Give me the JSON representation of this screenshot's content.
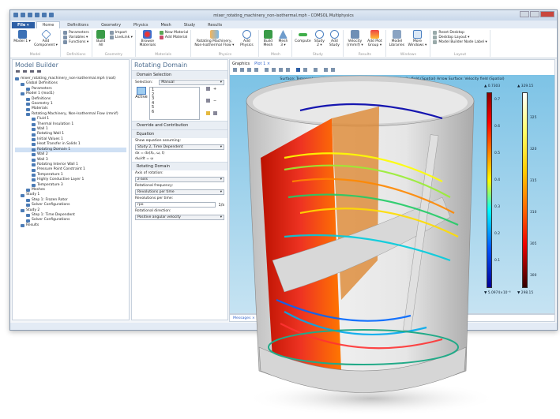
{
  "window": {
    "title": "mixer_rotating_machinery_non-isothermal.mph - COMSOL Multiphysics"
  },
  "menu_tabs": [
    "File ▾",
    "Home",
    "Definitions",
    "Geometry",
    "Physics",
    "Mesh",
    "Study",
    "Results"
  ],
  "ribbon": {
    "model": {
      "label": "Model",
      "items": [
        "Model 1 ▾",
        "Add Component ▾"
      ]
    },
    "definitions": {
      "label": "Definitions",
      "items": [
        "Parameters",
        "Variables ▾",
        "Functions ▾"
      ]
    },
    "geometry": {
      "label": "Geometry",
      "build": "Build All",
      "items": [
        "Import",
        "LiveLink ▾"
      ]
    },
    "materials": {
      "label": "Materials",
      "browse": "Browse Materials",
      "items": [
        "New Material",
        "Add Material"
      ]
    },
    "physics": {
      "label": "Physics",
      "items": [
        "Rotating Machinery, Non-Isothermal Flow ▾",
        "Add Physics"
      ]
    },
    "mesh": {
      "label": "Mesh",
      "items": [
        "Build Mesh",
        "Mesh 3 ▾"
      ]
    },
    "study": {
      "label": "Study",
      "items": [
        "Compute",
        "Study 2 ▾",
        "Add Study"
      ]
    },
    "results": {
      "label": "Results",
      "items": [
        "Velocity (rmmif) ▾",
        "Add Plot Group ▾"
      ]
    },
    "windows": {
      "label": "Windows",
      "items": [
        "Model Libraries",
        "More Windows ▾"
      ]
    },
    "layout": {
      "label": "Layout",
      "items": [
        "Reset Desktop",
        "Desktop Layout ▾",
        "Model Builder Node Label ▾"
      ]
    }
  },
  "model_builder": {
    "title": "Model Builder",
    "tree": [
      {
        "label": "mixer_rotating_machinery_non-isothermal.mph (root)",
        "level": 0
      },
      {
        "label": "Global Definitions",
        "level": 1
      },
      {
        "label": "Parameters",
        "level": 2
      },
      {
        "label": "Model 1 (mod1)",
        "level": 1
      },
      {
        "label": "Definitions",
        "level": 2
      },
      {
        "label": "Geometry 1",
        "level": 2
      },
      {
        "label": "Materials",
        "level": 2
      },
      {
        "label": "Rotating Machinery, Non-Isothermal Flow (rmnif)",
        "level": 2
      },
      {
        "label": "Fluid 1",
        "level": 3
      },
      {
        "label": "Thermal Insulation 1",
        "level": 3
      },
      {
        "label": "Wall 1",
        "level": 3
      },
      {
        "label": "Rotating Wall 1",
        "level": 3
      },
      {
        "label": "Initial Values 1",
        "level": 3
      },
      {
        "label": "Heat Transfer in Solids 1",
        "level": 3
      },
      {
        "label": "Rotating Domain 1",
        "level": 3,
        "selected": true
      },
      {
        "label": "Wall 2",
        "level": 3
      },
      {
        "label": "Wall 3",
        "level": 3
      },
      {
        "label": "Rotating Interior Wall 1",
        "level": 3
      },
      {
        "label": "Pressure Point Constraint 1",
        "level": 3
      },
      {
        "label": "Temperature 1",
        "level": 3
      },
      {
        "label": "Highly Conductive Layer 1",
        "level": 3
      },
      {
        "label": "Temperature 3",
        "level": 3
      },
      {
        "label": "Meshes",
        "level": 2
      },
      {
        "label": "Study 1",
        "level": 1
      },
      {
        "label": "Step 1: Frozen Rotor",
        "level": 2
      },
      {
        "label": "Solver Configurations",
        "level": 2
      },
      {
        "label": "Study 2",
        "level": 1
      },
      {
        "label": "Step 1: Time Dependent",
        "level": 2
      },
      {
        "label": "Solver Configurations",
        "level": 2
      },
      {
        "label": "Results",
        "level": 1
      }
    ]
  },
  "settings": {
    "title": "Rotating Domain",
    "domain_selection": "Domain Selection",
    "selection_label": "Selection:",
    "selection_value": "Manual",
    "active": "Active",
    "domains": [
      "1",
      "2",
      "3",
      "4",
      "5",
      "6"
    ],
    "override": "Override and Contribution",
    "equation": "Equation",
    "show_eq_label": "Show equation assuming:",
    "show_eq_value": "Study 2, Time Dependent",
    "eq1": "dx = dx(Xₚ, ω, t)",
    "eq2": "dω/dt = ω",
    "rotating_domain": "Rotating Domain",
    "axis_label": "Axis of rotation:",
    "axis_value": "z-axis",
    "freq_label": "Rotational frequency:",
    "freq_value": "Revolutions per time",
    "rpt_label": "Revolutions per time:",
    "rpt_value": "rpo",
    "rpt_unit": "1/s",
    "dir_label": "Rotational direction:",
    "dir_value": "Positive angular velocity"
  },
  "graphics": {
    "tabs": [
      "Graphics",
      "Plot 1 ×"
    ],
    "caption": "Surface: Temperature (K) Contour: Temperature (K) Streamline: Velocity field (Spatial) Arrow Surface: Velocity field (Spatial)",
    "colorbar_velocity": {
      "max": "▲ 0.7303",
      "min": "▼ 5.0974×10⁻⁶",
      "ticks": [
        "0.7",
        "0.6",
        "0.5",
        "0.4",
        "0.3",
        "0.2",
        "0.1"
      ],
      "range": [
        0,
        0.7303
      ]
    },
    "colorbar_temperature": {
      "max": "▲ 329.15",
      "min": "▼ 298.15",
      "ticks": [
        "325",
        "320",
        "315",
        "310",
        "305",
        "300"
      ],
      "range": [
        298.15,
        329.15
      ]
    }
  },
  "bottom": {
    "tabs": [
      "Messages ×",
      "Pr"
    ],
    "status": "8 GB"
  }
}
